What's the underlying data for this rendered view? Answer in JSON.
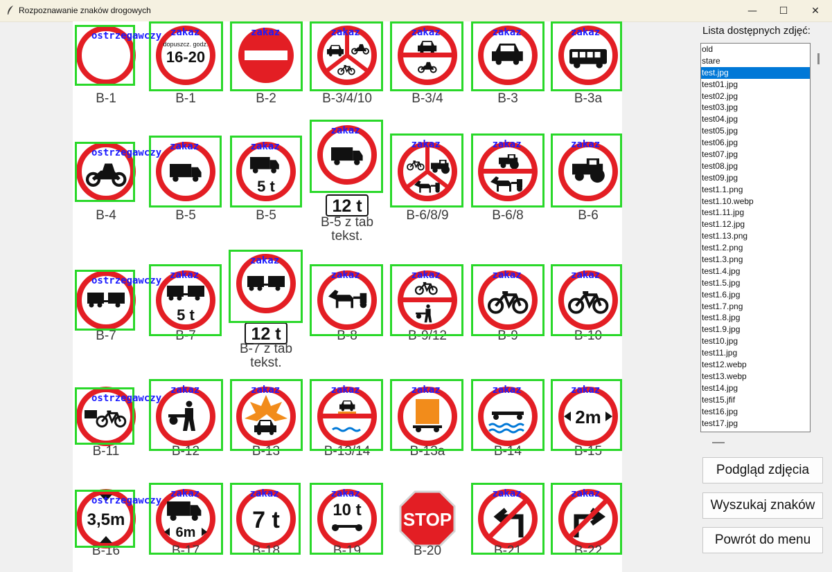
{
  "window": {
    "title": "Rozpoznawanie znaków drogowych",
    "minimize": "—",
    "maximize": "☐",
    "close": "✕"
  },
  "sidebar": {
    "list_title": "Lista dostępnych zdjęć:",
    "selected_item": "test.jpg",
    "files": [
      "old",
      "stare",
      "test.jpg",
      "test01.jpg",
      "test02.jpg",
      "test03.jpg",
      "test04.jpg",
      "test05.jpg",
      "test06.jpg",
      "test07.jpg",
      "test08.jpg",
      "test09.jpg",
      "test1.1.png",
      "test1.10.webp",
      "test1.11.jpg",
      "test1.12.jpg",
      "test1.13.png",
      "test1.2.png",
      "test1.3.png",
      "test1.4.jpg",
      "test1.5.jpg",
      "test1.6.jpg",
      "test1.7.png",
      "test1.8.jpg",
      "test1.9.jpg",
      "test10.jpg",
      "test11.jpg",
      "test12.webp",
      "test13.webp",
      "test14.jpg",
      "test15.jfif",
      "test16.jpg",
      "test17.jpg"
    ],
    "buttons": {
      "preview": "Podgląd zdjęcia",
      "search": "Wyszukaj znaków",
      "back": "Powrót do menu"
    }
  },
  "preview": {
    "detection_color": "#29d829",
    "label_color": "#1a1aff",
    "labels": {
      "warning": "ostrzegawczy",
      "prohibition": "zakaz"
    },
    "codes": {
      "r1": [
        "B-1",
        "B-1",
        "B-2",
        "B-3/4/10",
        "B-3/4",
        "B-3",
        "B-3a"
      ],
      "r2": [
        "B-4",
        "B-5",
        "B-5",
        "B-5 z tab\ntekst.",
        "B-6/8/9",
        "B-6/8",
        "B-6"
      ],
      "r3": [
        "B-7",
        "B-7",
        "B-7 z tab\ntekst.",
        "B-8",
        "B-9/12",
        "B-9",
        "B-10"
      ],
      "r4": [
        "B-11",
        "B-12",
        "B-13",
        "B-13/14",
        "B-13a",
        "B-14",
        "B-15"
      ],
      "r5": [
        "B-16",
        "B-17",
        "B-18",
        "B-19",
        "B-20",
        "B-21",
        "B-22"
      ]
    },
    "sign_texts": {
      "b1_top": "dopuszcz. godz.",
      "b1_hours": "16-20",
      "b5_weight": "5 t",
      "plate_12t": "12 t",
      "b7_weight": "5 t",
      "b15": "2m",
      "b16": "3,5m",
      "b17": "6m",
      "b18": "7 t",
      "b19": "10 t",
      "stop": "STOP"
    }
  }
}
